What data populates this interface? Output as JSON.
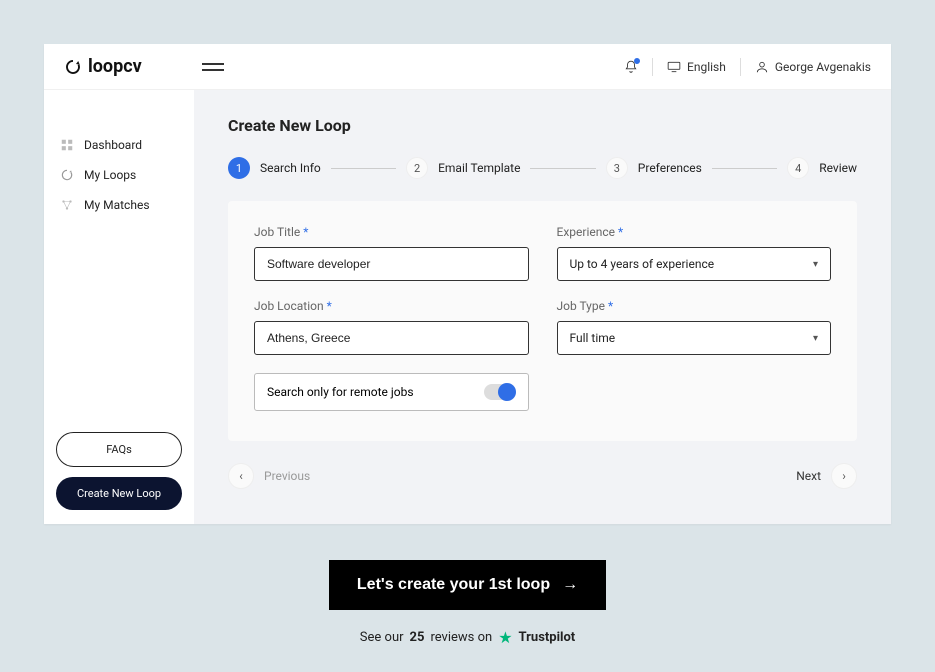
{
  "logo": "loopcv",
  "topbar": {
    "language": "English",
    "user": "George Avgenakis"
  },
  "sidebar": {
    "items": [
      {
        "label": "Dashboard"
      },
      {
        "label": "My Loops"
      },
      {
        "label": "My Matches"
      }
    ],
    "faqs": "FAQs",
    "create": "Create New Loop"
  },
  "page": {
    "title": "Create New Loop",
    "steps": [
      {
        "num": "1",
        "label": "Search Info"
      },
      {
        "num": "2",
        "label": "Email Template"
      },
      {
        "num": "3",
        "label": "Preferences"
      },
      {
        "num": "4",
        "label": "Review"
      }
    ],
    "form": {
      "job_title_label": "Job Title",
      "job_title_value": "Software developer",
      "experience_label": "Experience",
      "experience_value": "Up to 4 years of experience",
      "location_label": "Job Location",
      "location_value": "Athens, Greece",
      "jobtype_label": "Job Type",
      "jobtype_value": "Full time",
      "remote_label": "Search only for remote jobs"
    },
    "prev": "Previous",
    "next": "Next"
  },
  "cta": "Let's create your 1st loop",
  "trust": {
    "pre": "See our",
    "count": "25",
    "post": "reviews on",
    "brand": "Trustpilot"
  }
}
